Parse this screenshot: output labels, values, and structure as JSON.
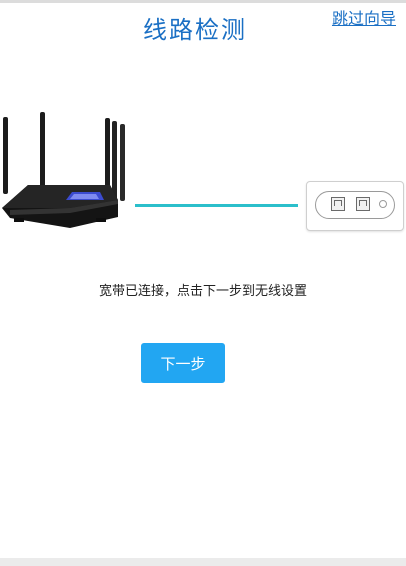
{
  "header": {
    "title": "线路检测",
    "skip_link": "跳过向导"
  },
  "status": {
    "message": "宽带已连接，点击下一步到无线设置"
  },
  "actions": {
    "next_label": "下一步"
  },
  "colors": {
    "title": "#1a6fc4",
    "line": "#2bbfcb",
    "button": "#22a6f2"
  },
  "icons": {
    "router": "router-icon",
    "port_panel": "ethernet-ports-icon"
  }
}
